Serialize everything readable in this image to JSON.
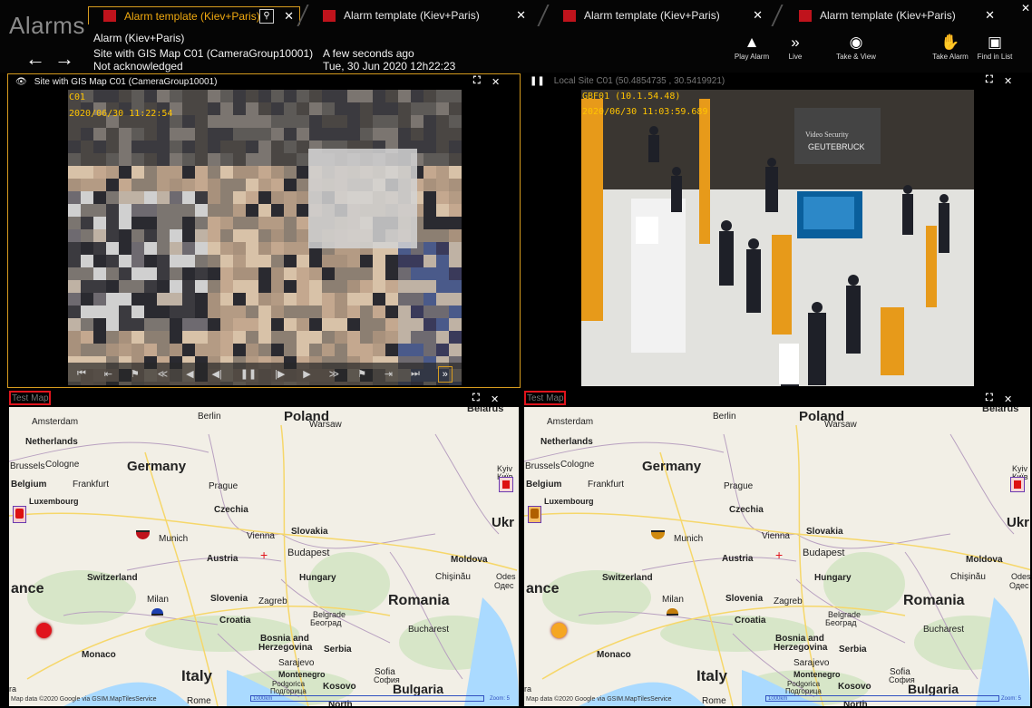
{
  "app": {
    "title": "Alarms"
  },
  "tabs": [
    {
      "label": "Alarm template (Kiev+Paris)",
      "active": true
    },
    {
      "label": "Alarm template (Kiev+Paris)"
    },
    {
      "label": "Alarm template (Kiev+Paris)"
    },
    {
      "label": "Alarm template (Kiev+Paris)"
    }
  ],
  "alarm": {
    "name": "Alarm (Kiev+Paris)",
    "site": "Site with GIS Map C01 (CameraGroup10001)",
    "status": "Not acknowledged",
    "relative_time": "A few seconds ago",
    "datetime": "Tue, 30 Jun 2020  12h22:23"
  },
  "actions": [
    {
      "label": "Play Alarm",
      "icon": "play-alarm-icon"
    },
    {
      "label": "Live",
      "icon": "live-icon"
    },
    {
      "label": "Take & View",
      "icon": "take-view-icon"
    },
    {
      "label": "Take Alarm",
      "icon": "take-alarm-icon"
    },
    {
      "label": "Find in List",
      "icon": "find-in-list-icon"
    }
  ],
  "panels": {
    "video1": {
      "title": "Site with GIS Map C01 (CameraGroup10001)",
      "osd_cam": "C01",
      "osd_time": "2020/06/30 11:22:54"
    },
    "video2": {
      "title": "Local Site C01 (50.4854735 , 30.5419921)",
      "osd_cam": "GBF01 (10.1.54.48)",
      "osd_time": "2020/06/30 11:03:59.689",
      "sign": "Video Security GEUTEBRUCK"
    },
    "map1": {
      "title": "Test Map"
    },
    "map2": {
      "title": "Test Map"
    }
  },
  "map": {
    "labels": {
      "belarus": "Belarus",
      "poland": "Poland",
      "berlin": "Berlin",
      "warsaw": "Warsaw",
      "amsterdam": "Amsterdam",
      "netherlands": "Netherlands",
      "brussels": "Brussels",
      "cologne": "Cologne",
      "germany": "Germany",
      "belgium": "Belgium",
      "frankfurt": "Frankfurt",
      "prague": "Prague",
      "luxembourg": "Luxembourg",
      "czechia": "Czechia",
      "kyiv": "Kyiv",
      "kyiv_cyr": "Київ",
      "ukraine": "Ukr",
      "munich": "Munich",
      "vienna": "Vienna",
      "slovakia": "Slovakia",
      "budapest": "Budapest",
      "austria": "Austria",
      "moldova": "Moldova",
      "switzerland": "Switzerland",
      "hungary": "Hungary",
      "chisinau": "Chişinău",
      "odesa": "Odes",
      "odesa_cyr": "Одес",
      "france": "ance",
      "milan": "Milan",
      "slovenia": "Slovenia",
      "zagreb": "Zagreb",
      "romania": "Romania",
      "croatia": "Croatia",
      "belgrade": "Belgrade",
      "belgrade_cyr": "Београд",
      "bosnia1": "Bosnia and",
      "bosnia2": "Herzegovina",
      "bucharest": "Bucharest",
      "monaco": "Monaco",
      "serbia": "Serbia",
      "sarajevo": "Sarajevo",
      "italy": "Italy",
      "montenegro": "Montenegro",
      "sofia": "Sofia",
      "sofia_cyr": "София",
      "podgorica": "Podgorica",
      "podgorica_cyr": "Подгорица",
      "kosovo": "Kosovo",
      "bulgaria": "Bulgaria",
      "rome": "Rome",
      "north": "North",
      "ra": "ra"
    },
    "attribution": "Map data ©2020 Google via GSIM.MapTilesService",
    "scale": "1000km",
    "zoom": "Zoom: 5"
  },
  "colors": {
    "accent": "#f0a90f",
    "tab_icon": "#c0131c",
    "marker_red": "#e0141c",
    "marker_orange": "#f5a623"
  }
}
